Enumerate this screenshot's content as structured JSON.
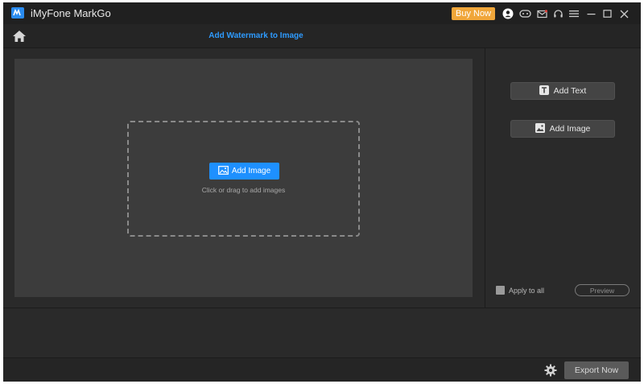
{
  "window": {
    "app_title": "iMyFone MarkGo",
    "buy_label": "Buy Now",
    "icons": [
      "user-icon",
      "gamepad-icon",
      "mail-icon",
      "headset-icon",
      "menu-icon",
      "minimize-icon",
      "maximize-icon",
      "close-icon"
    ]
  },
  "nav": {
    "page_title": "Add Watermark to Image"
  },
  "main": {
    "add_image_label": "Add Image",
    "drop_hint": "Click or drag to add images"
  },
  "sidebar": {
    "add_text_label": "Add Text",
    "add_image_label": "Add Image",
    "apply_to_all_label": "Apply to all",
    "apply_to_all_checked": false,
    "preview_label": "Preview"
  },
  "footer": {
    "export_label": "Export Now"
  },
  "colors": {
    "accent": "#1e90ff",
    "title_blue": "#2e9bff",
    "buy_orange": "#f0a63a",
    "background": "#2a2a2a",
    "canvas": "#3c3c3c"
  }
}
